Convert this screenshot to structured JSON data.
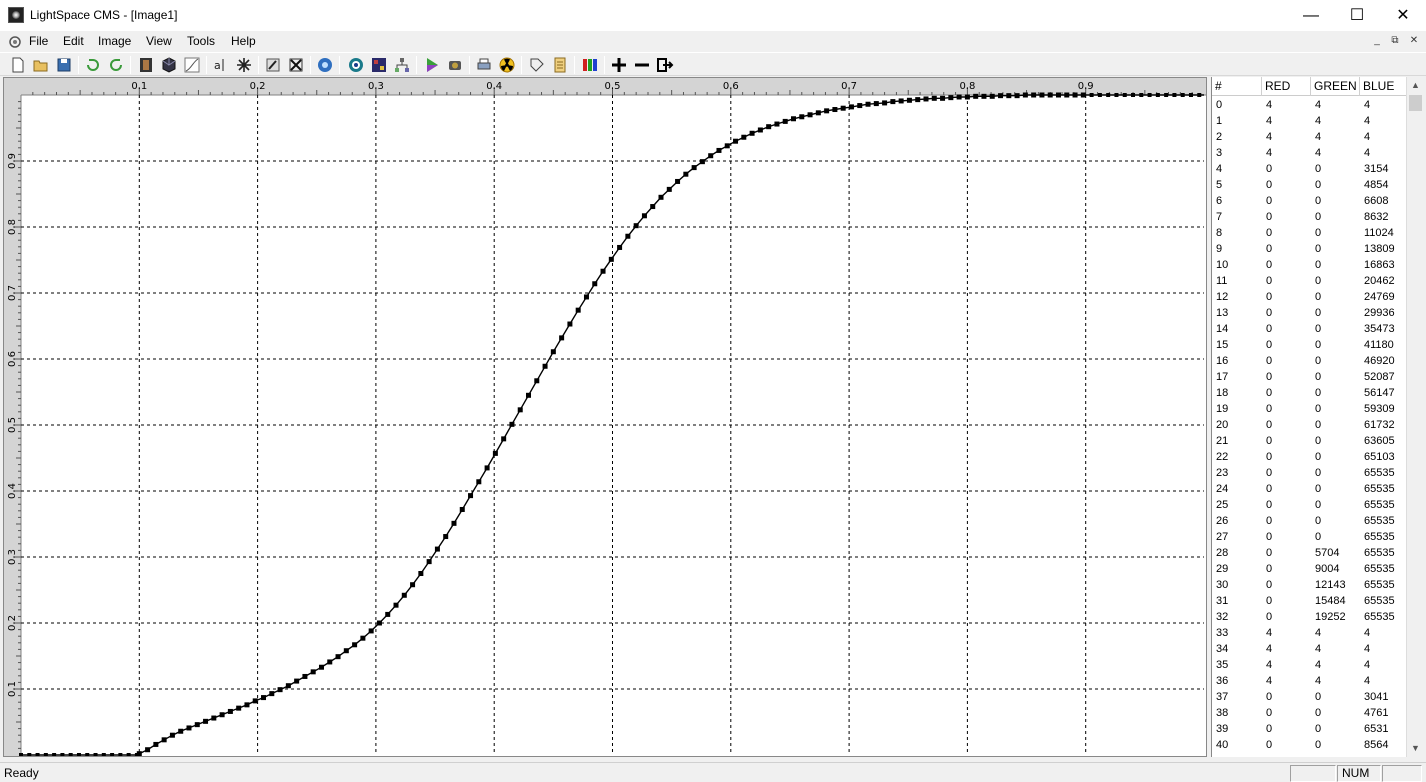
{
  "window": {
    "title": "LightSpace CMS - [Image1]",
    "minimize": "—",
    "maximize": "☐",
    "close": "✕"
  },
  "menu": [
    "File",
    "Edit",
    "Image",
    "View",
    "Tools",
    "Help"
  ],
  "mdi": {
    "minimize": "_",
    "restore": "⧉",
    "close": "✕"
  },
  "toolbar_icons": [
    "new-file-icon",
    "open-folder-icon",
    "save-icon",
    "undo-icon",
    "redo-icon",
    "film-strip-icon",
    "cube-icon",
    "curve-icon",
    "text-tool-icon",
    "asterisk-icon",
    "edit-icon",
    "cross-out-icon",
    "globe-icon",
    "target-icon",
    "color-grid-icon",
    "network-icon",
    "play-icon",
    "camera-icon",
    "printer-icon",
    "radiation-icon",
    "tag-icon",
    "label-icon",
    "rgb-bars-icon",
    "plus-icon",
    "minus-icon",
    "export-icon"
  ],
  "table": {
    "headers": [
      "#",
      "RED",
      "GREEN",
      "BLUE"
    ],
    "rows": [
      [
        "0",
        "4",
        "4",
        "4"
      ],
      [
        "1",
        "4",
        "4",
        "4"
      ],
      [
        "2",
        "4",
        "4",
        "4"
      ],
      [
        "3",
        "4",
        "4",
        "4"
      ],
      [
        "4",
        "0",
        "0",
        "3154"
      ],
      [
        "5",
        "0",
        "0",
        "4854"
      ],
      [
        "6",
        "0",
        "0",
        "6608"
      ],
      [
        "7",
        "0",
        "0",
        "8632"
      ],
      [
        "8",
        "0",
        "0",
        "11024"
      ],
      [
        "9",
        "0",
        "0",
        "13809"
      ],
      [
        "10",
        "0",
        "0",
        "16863"
      ],
      [
        "11",
        "0",
        "0",
        "20462"
      ],
      [
        "12",
        "0",
        "0",
        "24769"
      ],
      [
        "13",
        "0",
        "0",
        "29936"
      ],
      [
        "14",
        "0",
        "0",
        "35473"
      ],
      [
        "15",
        "0",
        "0",
        "41180"
      ],
      [
        "16",
        "0",
        "0",
        "46920"
      ],
      [
        "17",
        "0",
        "0",
        "52087"
      ],
      [
        "18",
        "0",
        "0",
        "56147"
      ],
      [
        "19",
        "0",
        "0",
        "59309"
      ],
      [
        "20",
        "0",
        "0",
        "61732"
      ],
      [
        "21",
        "0",
        "0",
        "63605"
      ],
      [
        "22",
        "0",
        "0",
        "65103"
      ],
      [
        "23",
        "0",
        "0",
        "65535"
      ],
      [
        "24",
        "0",
        "0",
        "65535"
      ],
      [
        "25",
        "0",
        "0",
        "65535"
      ],
      [
        "26",
        "0",
        "0",
        "65535"
      ],
      [
        "27",
        "0",
        "0",
        "65535"
      ],
      [
        "28",
        "0",
        "5704",
        "65535"
      ],
      [
        "29",
        "0",
        "9004",
        "65535"
      ],
      [
        "30",
        "0",
        "12143",
        "65535"
      ],
      [
        "31",
        "0",
        "15484",
        "65535"
      ],
      [
        "32",
        "0",
        "19252",
        "65535"
      ],
      [
        "33",
        "4",
        "4",
        "4"
      ],
      [
        "34",
        "4",
        "4",
        "4"
      ],
      [
        "35",
        "4",
        "4",
        "4"
      ],
      [
        "36",
        "4",
        "4",
        "4"
      ],
      [
        "37",
        "0",
        "0",
        "3041"
      ],
      [
        "38",
        "0",
        "0",
        "4761"
      ],
      [
        "39",
        "0",
        "0",
        "6531"
      ],
      [
        "40",
        "0",
        "0",
        "8564"
      ]
    ]
  },
  "status": {
    "text": "Ready",
    "num": "NUM"
  },
  "chart_data": {
    "type": "line",
    "title": "",
    "xlabel": "",
    "ylabel": "",
    "xlim": [
      0,
      1
    ],
    "ylim": [
      0,
      1
    ],
    "grid": true,
    "x_ticks": [
      "0.1",
      "0.2",
      "0.3",
      "0.4",
      "0.5",
      "0.6",
      "0.7",
      "0.8",
      "0.9"
    ],
    "y_ticks": [
      "0.1",
      "0.2",
      "0.3",
      "0.4",
      "0.5",
      "0.6",
      "0.7",
      "0.8",
      "0.9"
    ],
    "series": [
      {
        "color": "#000000",
        "marker": "square",
        "x": [
          0.1,
          0.107,
          0.114,
          0.121,
          0.128,
          0.135,
          0.142,
          0.149,
          0.156,
          0.163,
          0.17,
          0.177,
          0.184,
          0.191,
          0.198,
          0.205,
          0.212,
          0.219,
          0.226,
          0.233,
          0.24,
          0.247,
          0.254,
          0.261,
          0.268,
          0.275,
          0.282,
          0.289,
          0.296,
          0.303,
          0.31,
          0.317,
          0.324,
          0.331,
          0.338,
          0.345,
          0.352,
          0.359,
          0.366,
          0.373,
          0.38,
          0.387,
          0.394,
          0.401,
          0.408,
          0.415,
          0.422,
          0.429,
          0.436,
          0.443,
          0.45,
          0.457,
          0.464,
          0.471,
          0.478,
          0.485,
          0.492,
          0.499,
          0.506,
          0.513,
          0.52,
          0.527,
          0.534,
          0.541,
          0.548,
          0.555,
          0.562,
          0.569,
          0.576,
          0.583,
          0.59,
          0.597,
          0.604,
          0.611,
          0.618,
          0.625,
          0.632,
          0.639,
          0.646,
          0.653,
          0.66,
          0.667,
          0.674,
          0.681,
          0.688,
          0.695,
          0.702,
          0.709,
          0.716,
          0.723,
          0.73,
          0.737,
          0.744,
          0.751,
          0.758,
          0.765,
          0.772,
          0.779,
          0.786,
          0.793,
          0.8,
          0.807,
          0.814,
          0.821,
          0.828,
          0.835,
          0.842,
          0.849,
          0.856,
          0.863,
          0.87,
          0.877,
          0.884,
          0.891,
          0.898
        ],
        "y": [
          0.002,
          0.008,
          0.016,
          0.023,
          0.03,
          0.036,
          0.041,
          0.046,
          0.051,
          0.056,
          0.061,
          0.066,
          0.071,
          0.076,
          0.082,
          0.087,
          0.093,
          0.099,
          0.105,
          0.112,
          0.119,
          0.126,
          0.133,
          0.141,
          0.149,
          0.158,
          0.167,
          0.177,
          0.188,
          0.2,
          0.213,
          0.227,
          0.242,
          0.258,
          0.275,
          0.293,
          0.312,
          0.331,
          0.351,
          0.372,
          0.393,
          0.414,
          0.435,
          0.457,
          0.479,
          0.501,
          0.523,
          0.545,
          0.567,
          0.589,
          0.611,
          0.632,
          0.653,
          0.674,
          0.694,
          0.714,
          0.733,
          0.751,
          0.769,
          0.786,
          0.802,
          0.817,
          0.831,
          0.845,
          0.857,
          0.869,
          0.88,
          0.89,
          0.899,
          0.908,
          0.916,
          0.923,
          0.93,
          0.936,
          0.942,
          0.947,
          0.952,
          0.956,
          0.96,
          0.964,
          0.967,
          0.97,
          0.973,
          0.976,
          0.978,
          0.98,
          0.982,
          0.984,
          0.986,
          0.987,
          0.988,
          0.99,
          0.991,
          0.992,
          0.993,
          0.994,
          0.995,
          0.995,
          0.996,
          0.997,
          0.997,
          0.998,
          0.998,
          0.998,
          0.999,
          0.999,
          0.999,
          1.0,
          1.0,
          1.0,
          1.0,
          1.0,
          1.0,
          1.0,
          1.0
        ],
        "pre_flat": {
          "x": [
            0.0,
            0.1
          ],
          "y": [
            0.0,
            0.0
          ]
        },
        "post_flat": {
          "x": [
            0.898,
            1.0
          ],
          "y": [
            1.0,
            1.0
          ]
        }
      }
    ]
  }
}
